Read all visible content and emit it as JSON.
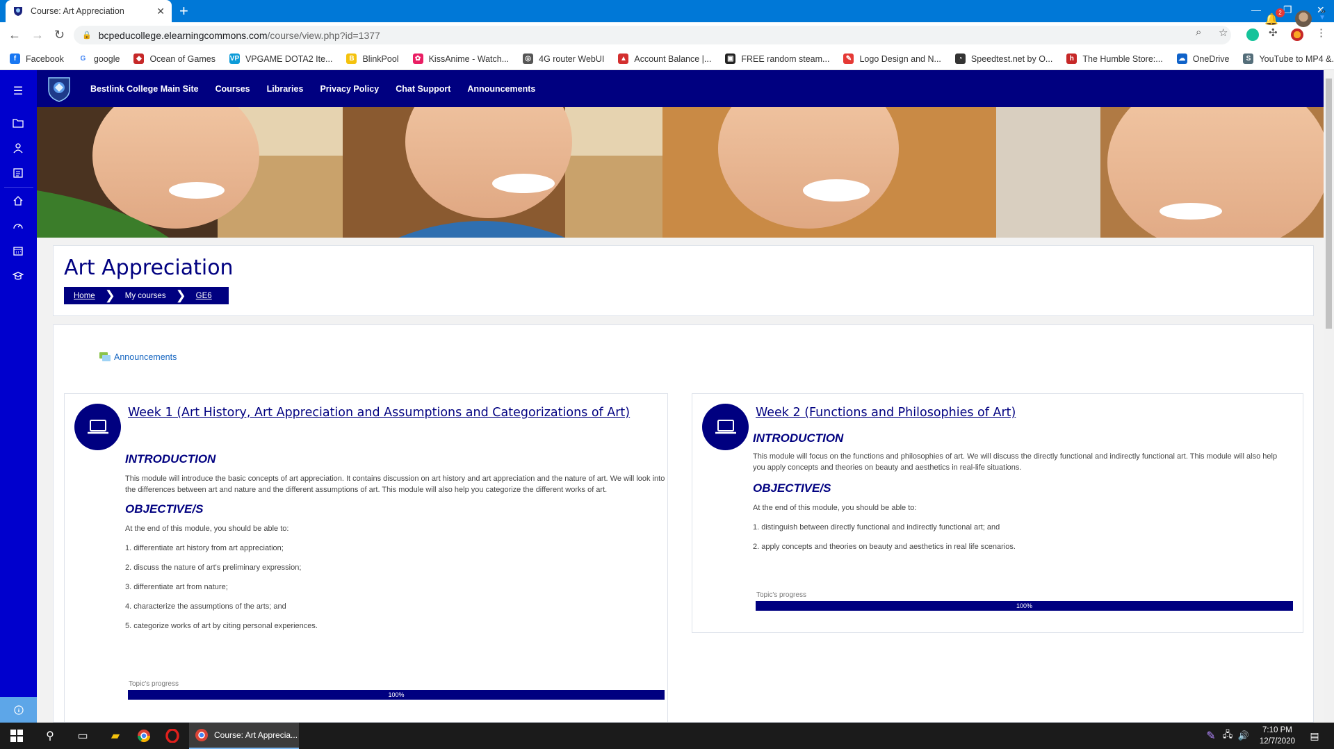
{
  "browser": {
    "tab_title": "Course: Art Appreciation",
    "close_glyph": "✕",
    "newtab_glyph": "+",
    "url_host": "bcpeducollege.elearningcommons.com",
    "url_path": "/course/view.php?id=1377",
    "bookmarks": [
      {
        "label": "Facebook",
        "icon": "facebook-icon",
        "color": "#1877f2",
        "glyph": "f"
      },
      {
        "label": "google",
        "icon": "google-icon",
        "color": "#ffffff",
        "glyph": "G"
      },
      {
        "label": "Ocean of Games",
        "icon": "gamepad-icon",
        "color": "#c62828",
        "glyph": "◆"
      },
      {
        "label": "VPGAME DOTA2 Ite...",
        "icon": "vpgame-icon",
        "color": "#0d9bd8",
        "glyph": "VP"
      },
      {
        "label": "BlinkPool",
        "icon": "blinkpool-icon",
        "color": "#f4c20d",
        "glyph": "B"
      },
      {
        "label": "KissAnime - Watch...",
        "icon": "kissanime-icon",
        "color": "#e91e63",
        "glyph": "✿"
      },
      {
        "label": "4G router WebUI",
        "icon": "router-icon",
        "color": "#555555",
        "glyph": "◎"
      },
      {
        "label": "Account Balance |...",
        "icon": "account-icon",
        "color": "#d32f2f",
        "glyph": "▲"
      },
      {
        "label": "FREE random steam...",
        "icon": "steam-icon",
        "color": "#222222",
        "glyph": "▣"
      },
      {
        "label": "Logo Design and N...",
        "icon": "logo-design-icon",
        "color": "#e53935",
        "glyph": "✎"
      },
      {
        "label": "Speedtest.net by O...",
        "icon": "speedtest-icon",
        "color": "#333333",
        "glyph": "◔"
      },
      {
        "label": "The Humble Store:...",
        "icon": "humble-icon",
        "color": "#c62828",
        "glyph": "h"
      },
      {
        "label": "OneDrive",
        "icon": "onedrive-icon",
        "color": "#0f62c9",
        "glyph": "☁"
      },
      {
        "label": "YouTube to MP4 &...",
        "icon": "youtube-mp4-icon",
        "color": "#546e7a",
        "glyph": "S"
      }
    ],
    "more_glyph": "»"
  },
  "nav": {
    "links": [
      "Bestlink College Main Site",
      "Courses",
      "Libraries",
      "Privacy Policy",
      "Chat Support",
      "Announcements"
    ],
    "notification_count": "2"
  },
  "course": {
    "title": "Art Appreciation",
    "breadcrumb": [
      "Home",
      "My courses",
      "GE6"
    ],
    "announcements_label": "Announcements"
  },
  "weeks": [
    {
      "title": "Week 1 (Art History, Art Appreciation and Assumptions and Categorizations of Art)",
      "intro_heading": "INTRODUCTION",
      "intro_text": "This module will introduce the basic concepts of art appreciation. It contains discussion on art history and art appreciation and the nature of art. We will look into the differences between art and nature and the different assumptions of art. This module will also help you categorize the different works of art.",
      "obj_heading": "OBJECTIVE/S",
      "obj_lead": "At the end of this module, you should be able to:",
      "objectives": [
        "1. differentiate art history from art appreciation;",
        "2. discuss the nature of art's preliminary expression;",
        "3. differentiate art from nature;",
        "4. characterize the assumptions of the arts; and",
        "5. categorize works of art by citing personal experiences."
      ],
      "progress_label": "Topic's progress",
      "progress_value": "100%"
    },
    {
      "title": "Week 2 (Functions and Philosophies of Art)",
      "intro_heading": "INTRODUCTION",
      "intro_text": "This module will focus on the functions and philosophies of art. We will discuss the directly functional and indirectly functional art. This module will also help you apply concepts and theories on beauty and aesthetics in real-life situations.",
      "obj_heading": "OBJECTIVE/S",
      "obj_lead": "At the end of this module, you should be able to:",
      "objectives": [
        "1. distinguish between directly functional and indirectly functional art; and",
        "2. apply concepts and theories on beauty and aesthetics in real life scenarios."
      ],
      "progress_label": "Topic's progress",
      "progress_value": "100%"
    }
  ],
  "taskbar": {
    "active_label": "Course: Art Apprecia...",
    "time": "7:10 PM",
    "date": "12/7/2020"
  },
  "colors": {
    "brand_navy": "#000080",
    "drawer_blue": "#0000cd",
    "chrome_blue": "#0078d7"
  }
}
